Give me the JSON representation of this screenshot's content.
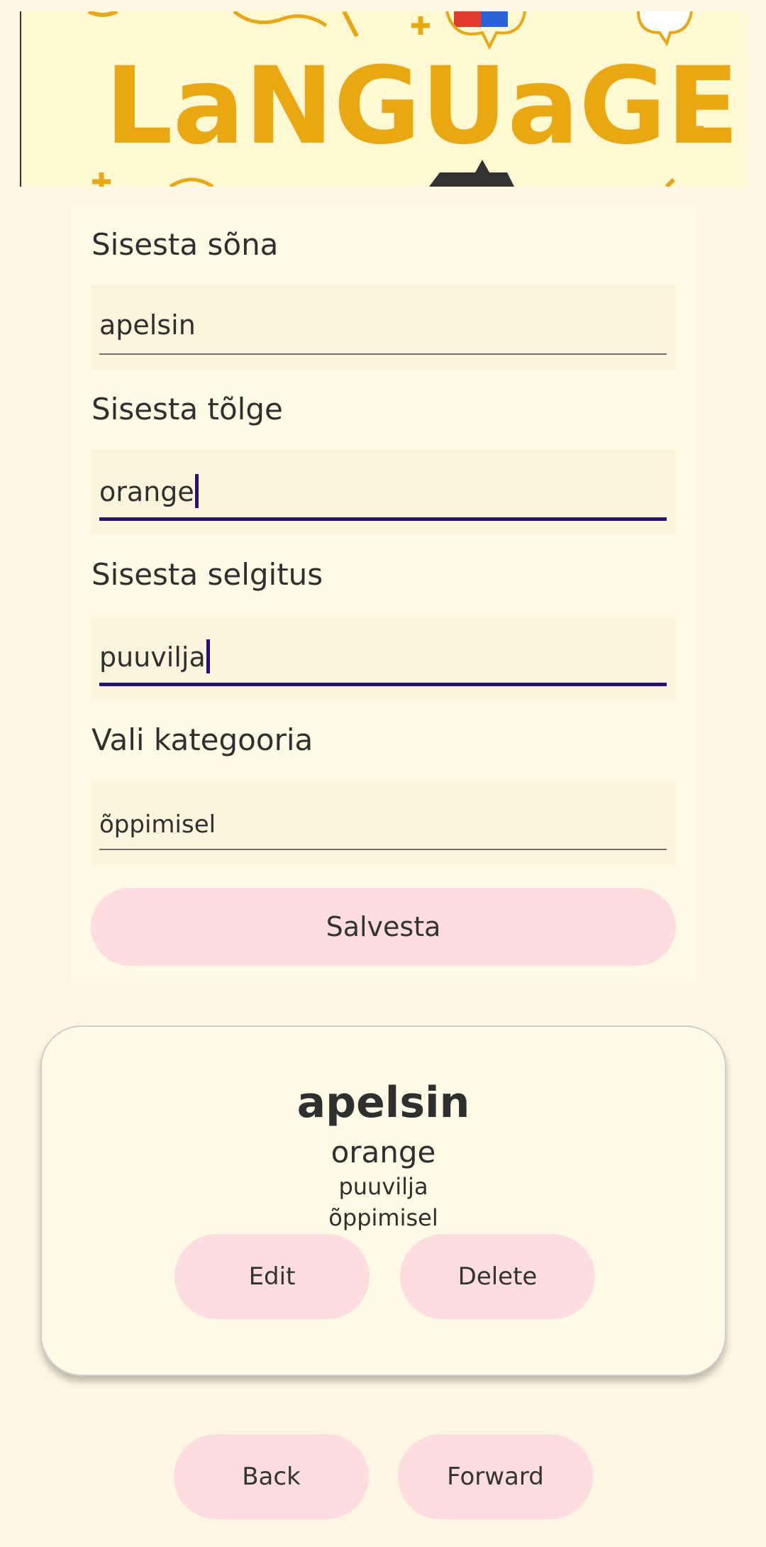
{
  "banner": {
    "text": "LaNGUaGE"
  },
  "form": {
    "word_label": "Sisesta sõna",
    "word_value": "apelsin",
    "translation_label": "Sisesta tõlge",
    "translation_value": "orange",
    "explanation_label": "Sisesta selgitus",
    "explanation_value": "puuvilja",
    "category_label": "Vali kategooria",
    "category_value": "õppimisel",
    "save_label": "Salvesta"
  },
  "card": {
    "word": "apelsin",
    "translation": "orange",
    "explanation": "puuvilja",
    "category": "õppimisel",
    "edit_label": "Edit",
    "delete_label": "Delete"
  },
  "nav": {
    "back_label": "Back",
    "forward_label": "Forward"
  },
  "colors": {
    "background": "#fdf6e3",
    "panel": "#fefae6",
    "field": "#fdf4dd",
    "button": "#fddde1",
    "focus": "#25127a",
    "banner_text": "#e9a712"
  }
}
